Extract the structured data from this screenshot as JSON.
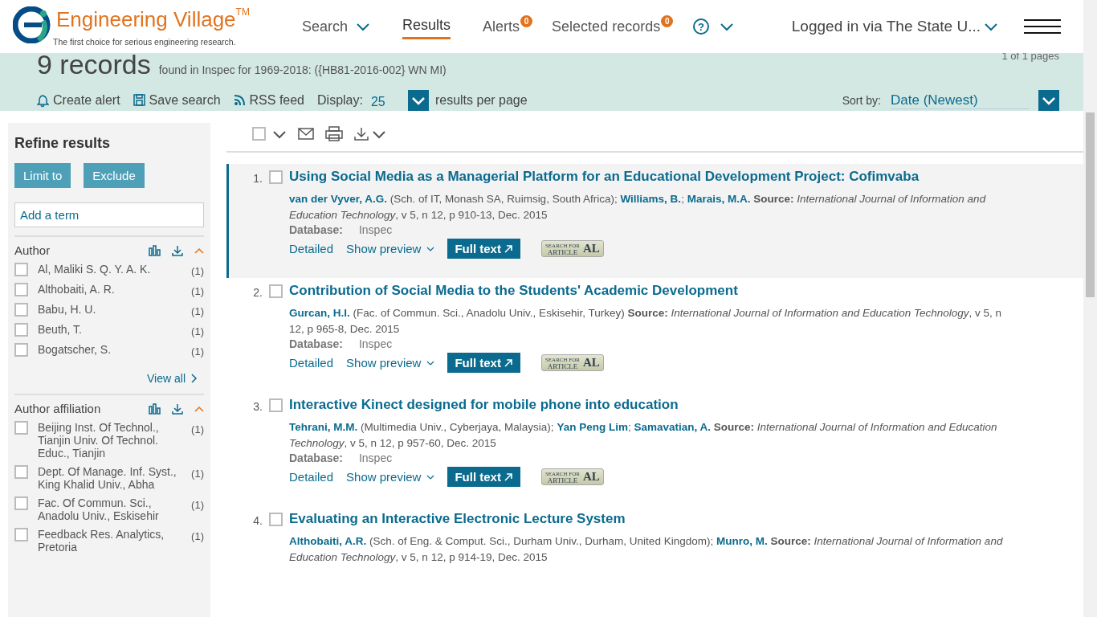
{
  "header": {
    "logo_name": "Engineering Village",
    "logo_mark": "TM",
    "tagline": "The first choice for serious engineering research.",
    "nav": [
      {
        "label": "Search",
        "kind": "dropdown",
        "selected": false
      },
      {
        "label": "Results",
        "kind": "plain",
        "selected": true
      },
      {
        "label": "Alerts",
        "kind": "badge",
        "badge": "0",
        "selected": false
      },
      {
        "label": "Selected records",
        "kind": "badge",
        "badge": "0",
        "selected": false
      }
    ],
    "help_mark": "?",
    "account": "Logged in via The State U..."
  },
  "summary": {
    "count": "9 records",
    "found": "found in Inspec for 1969-2018: ({HB81-2016-002} WN MI)",
    "pages": "1 of 1 pages",
    "actions": [
      {
        "kind": "alert",
        "label": "Create alert"
      },
      {
        "kind": "save",
        "label": "Save search"
      },
      {
        "kind": "rss",
        "label": "RSS feed"
      }
    ],
    "display_label": "Display:",
    "display_value": "25",
    "per_page": "results per page",
    "sort_label": "Sort by:",
    "sort_value": "Date (Newest)"
  },
  "sidebar": {
    "title": "Refine results",
    "buttons": [
      "Limit to",
      "Exclude"
    ],
    "term_placeholder": "Add a term",
    "facets": [
      {
        "title": "Author",
        "expanded": true,
        "view_all": "View all",
        "items": [
          {
            "label": "Al, Maliki S. Q. Y. A. K.",
            "count": "(1)",
            "checked": false
          },
          {
            "label": "Althobaiti, A. R.",
            "count": "(1)",
            "checked": false
          },
          {
            "label": "Babu, H. U.",
            "count": "(1)",
            "checked": false
          },
          {
            "label": "Beuth, T.",
            "count": "(1)",
            "checked": false
          },
          {
            "label": "Bogatscher, S.",
            "count": "(1)",
            "checked": false
          }
        ]
      },
      {
        "title": "Author affiliation",
        "expanded": true,
        "items": [
          {
            "label": "Beijing Inst. Of Technol., Tianjin Univ. Of Technol. Educ., Tianjin",
            "count": "(1)",
            "checked": false
          },
          {
            "label": "Dept. Of Manage. Inf. Syst., King Khalid Univ., Abha",
            "count": "(1)",
            "checked": false
          },
          {
            "label": "Fac. Of Commun. Sci., Anadolu Univ., Eskisehir",
            "count": "(1)",
            "checked": false
          },
          {
            "label": "Feedback Res. Analytics, Pretoria",
            "count": "(1)",
            "checked": false
          }
        ]
      }
    ]
  },
  "toolbar": {
    "select_all": {
      "checked": false
    }
  },
  "results": [
    {
      "number": "1.",
      "highlighted": true,
      "checked": false,
      "title": "Using Social Media as a Managerial Platform for an Educational Development Project: Cofimvaba",
      "authors": [
        {
          "name": "van der Vyver, A.G.",
          "affiliation": "(Sch. of IT, Monash SA, Ruimsig, South Africa)",
          "sep": ";"
        },
        {
          "name": "Williams, B.",
          "sep": ";"
        },
        {
          "name": "Marais, M.A."
        }
      ],
      "source_label": "Source:",
      "journal": "International Journal of Information and Education Technology",
      "details": ", v 5, n 12, p 910-13, Dec. 2015",
      "db_label": "Database:",
      "db": "Inspec",
      "detailed": "Detailed",
      "preview": "Show preview",
      "full_text": "Full text",
      "badge_top": "SEARCH FOR",
      "badge_bottom": "ARTICLE",
      "badge_mark": "AL"
    },
    {
      "number": "2.",
      "highlighted": false,
      "checked": false,
      "title": "Contribution of Social Media to the Students' Academic Development",
      "authors": [
        {
          "name": "Gurcan, H.I.",
          "affiliation": "(Fac. of Commun. Sci., Anadolu Univ., Eskisehir, Turkey)"
        }
      ],
      "source_label": "Source:",
      "journal": "International Journal of Information and Education Technology",
      "details": ", v 5, n 12, p 965-8, Dec. 2015",
      "db_label": "Database:",
      "db": "Inspec",
      "detailed": "Detailed",
      "preview": "Show preview",
      "full_text": "Full text",
      "badge_top": "SEARCH FOR",
      "badge_bottom": "ARTICLE",
      "badge_mark": "AL"
    },
    {
      "number": "3.",
      "highlighted": false,
      "checked": false,
      "title": "Interactive Kinect designed for mobile phone into education",
      "authors": [
        {
          "name": "Tehrani, M.M.",
          "affiliation": "(Multimedia Univ., Cyberjaya, Malaysia)",
          "sep": ";"
        },
        {
          "name": "Yan Peng Lim",
          "sep": ";"
        },
        {
          "name": "Samavatian, A."
        }
      ],
      "source_label": "Source:",
      "journal": "International Journal of Information and Education Technology",
      "details": ", v 5, n 12, p 957-60, Dec. 2015",
      "db_label": "Database:",
      "db": "Inspec",
      "detailed": "Detailed",
      "preview": "Show preview",
      "full_text": "Full text",
      "badge_top": "SEARCH FOR",
      "badge_bottom": "ARTICLE",
      "badge_mark": "AL"
    },
    {
      "number": "4.",
      "highlighted": false,
      "checked": false,
      "title": "Evaluating an Interactive Electronic Lecture System",
      "authors": [
        {
          "name": "Althobaiti, A.R.",
          "affiliation": "(Sch. of Eng. & Comput. Sci., Durham Univ., Durham, United Kingdom)",
          "sep": ";"
        },
        {
          "name": "Munro, M."
        }
      ],
      "source_label": "Source:",
      "journal": "International Journal of Information and Education Technology",
      "details": ", v 5, n 12, p 914-19, Dec. 2015"
    }
  ]
}
